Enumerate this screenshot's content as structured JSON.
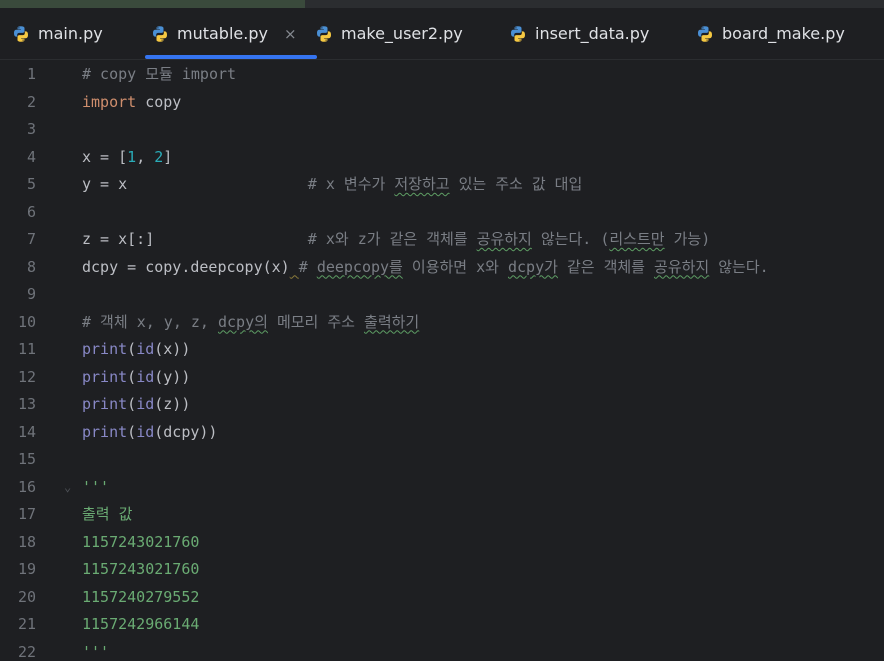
{
  "tabs": [
    {
      "label": "main.py",
      "active": false,
      "icon": "python-icon"
    },
    {
      "label": "mutable.py",
      "active": true,
      "icon": "python-icon",
      "close": "×"
    },
    {
      "label": "make_user2.py",
      "active": false,
      "icon": "python-icon"
    },
    {
      "label": "insert_data.py",
      "active": false,
      "icon": "python-icon"
    },
    {
      "label": "board_make.py",
      "active": false,
      "icon": "python-icon"
    }
  ],
  "colors": {
    "background": "#1e1f22",
    "active_tab_underline": "#3574f0",
    "keyword": "#cf8e6d",
    "number": "#2aacb8",
    "comment": "#7a7e85",
    "builtin": "#8888c6",
    "string": "#6aab73",
    "line_number": "#6f737a"
  },
  "editor": {
    "fold_marker": "⌄",
    "lines": [
      {
        "number": "1",
        "tokens": [
          {
            "text": "# copy 모듈 import",
            "type": "comment"
          }
        ]
      },
      {
        "number": "2",
        "tokens": [
          {
            "text": "import",
            "type": "keyword"
          },
          {
            "text": " copy",
            "type": "plain"
          }
        ]
      },
      {
        "number": "3",
        "tokens": []
      },
      {
        "number": "4",
        "tokens": [
          {
            "text": "x = [",
            "type": "plain"
          },
          {
            "text": "1",
            "type": "number"
          },
          {
            "text": ", ",
            "type": "plain"
          },
          {
            "text": "2",
            "type": "number"
          },
          {
            "text": "]",
            "type": "plain"
          }
        ]
      },
      {
        "number": "5",
        "tokens": [
          {
            "text": "y = x                    ",
            "type": "plain"
          },
          {
            "text": "# x 변수가 ",
            "type": "comment"
          },
          {
            "text": "저장하고",
            "type": "comment",
            "typo": true
          },
          {
            "text": " 있는 주소 값 대입",
            "type": "comment"
          }
        ]
      },
      {
        "number": "6",
        "tokens": []
      },
      {
        "number": "7",
        "tokens": [
          {
            "text": "z = x[:]                 ",
            "type": "plain"
          },
          {
            "text": "# x와 z가 같은 객체를 ",
            "type": "comment"
          },
          {
            "text": "공유하지",
            "type": "comment",
            "typo": true
          },
          {
            "text": " 않는다. (",
            "type": "comment"
          },
          {
            "text": "리스트만",
            "type": "comment",
            "typo": true
          },
          {
            "text": " 가능)",
            "type": "comment"
          }
        ]
      },
      {
        "number": "8",
        "tokens": [
          {
            "text": "dcpy = copy.deepcopy(x)",
            "type": "plain"
          },
          {
            "text": " ",
            "type": "plain",
            "weak": true
          },
          {
            "text": "# ",
            "type": "comment"
          },
          {
            "text": "deepcopy를",
            "type": "comment",
            "typo": true
          },
          {
            "text": " 이용하면 x와 ",
            "type": "comment"
          },
          {
            "text": "dcpy가",
            "type": "comment",
            "typo": true
          },
          {
            "text": " 같은 객체를 ",
            "type": "comment"
          },
          {
            "text": "공유하지",
            "type": "comment",
            "typo": true
          },
          {
            "text": " 않는다.",
            "type": "comment"
          }
        ]
      },
      {
        "number": "9",
        "tokens": []
      },
      {
        "number": "10",
        "tokens": [
          {
            "text": "# 객체 x, y, z, ",
            "type": "comment"
          },
          {
            "text": "dcpy의",
            "type": "comment",
            "typo": true
          },
          {
            "text": " 메모리 주소 ",
            "type": "comment"
          },
          {
            "text": "출력하기",
            "type": "comment",
            "typo": true
          }
        ]
      },
      {
        "number": "11",
        "tokens": [
          {
            "text": "print",
            "type": "builtin"
          },
          {
            "text": "(",
            "type": "plain"
          },
          {
            "text": "id",
            "type": "builtin"
          },
          {
            "text": "(x))",
            "type": "plain"
          }
        ]
      },
      {
        "number": "12",
        "tokens": [
          {
            "text": "print",
            "type": "builtin"
          },
          {
            "text": "(",
            "type": "plain"
          },
          {
            "text": "id",
            "type": "builtin"
          },
          {
            "text": "(y))",
            "type": "plain"
          }
        ]
      },
      {
        "number": "13",
        "tokens": [
          {
            "text": "print",
            "type": "builtin"
          },
          {
            "text": "(",
            "type": "plain"
          },
          {
            "text": "id",
            "type": "builtin"
          },
          {
            "text": "(z))",
            "type": "plain"
          }
        ]
      },
      {
        "number": "14",
        "tokens": [
          {
            "text": "print",
            "type": "builtin"
          },
          {
            "text": "(",
            "type": "plain"
          },
          {
            "text": "id",
            "type": "builtin"
          },
          {
            "text": "(dcpy))",
            "type": "plain"
          }
        ]
      },
      {
        "number": "15",
        "tokens": []
      },
      {
        "number": "16",
        "tokens": [
          {
            "text": "'''",
            "type": "string"
          }
        ],
        "fold": true
      },
      {
        "number": "17",
        "tokens": [
          {
            "text": "출력 값",
            "type": "string"
          }
        ]
      },
      {
        "number": "18",
        "tokens": [
          {
            "text": "1157243021760",
            "type": "string"
          }
        ]
      },
      {
        "number": "19",
        "tokens": [
          {
            "text": "1157243021760",
            "type": "string"
          }
        ]
      },
      {
        "number": "20",
        "tokens": [
          {
            "text": "1157240279552",
            "type": "string"
          }
        ]
      },
      {
        "number": "21",
        "tokens": [
          {
            "text": "1157242966144",
            "type": "string"
          }
        ]
      },
      {
        "number": "22",
        "tokens": [
          {
            "text": "'''",
            "type": "string"
          }
        ]
      }
    ]
  }
}
